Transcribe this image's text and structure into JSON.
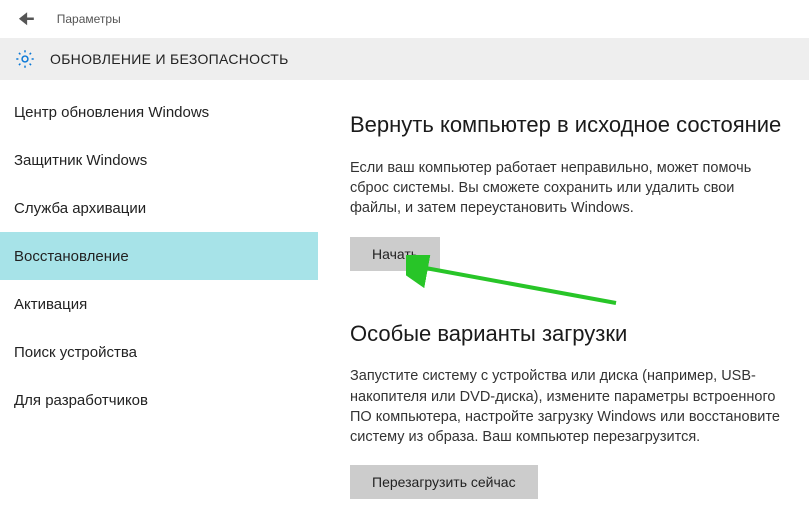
{
  "header": {
    "title": "Параметры"
  },
  "category": {
    "title": "ОБНОВЛЕНИЕ И БЕЗОПАСНОСТЬ"
  },
  "sidebar": {
    "items": [
      {
        "label": "Центр обновления Windows",
        "selected": false
      },
      {
        "label": "Защитник Windows",
        "selected": false
      },
      {
        "label": "Служба архивации",
        "selected": false
      },
      {
        "label": "Восстановление",
        "selected": true
      },
      {
        "label": "Активация",
        "selected": false
      },
      {
        "label": "Поиск устройства",
        "selected": false
      },
      {
        "label": "Для разработчиков",
        "selected": false
      }
    ]
  },
  "main": {
    "reset": {
      "heading": "Вернуть компьютер в исходное состояние",
      "text": "Если ваш компьютер работает неправильно, может помочь сброс системы. Вы сможете сохранить или удалить свои файлы, и затем переустановить Windows.",
      "button": "Начать"
    },
    "advanced": {
      "heading": "Особые варианты загрузки",
      "text": "Запустите систему с устройства или диска (например, USB-накопителя или DVD-диска), измените параметры встроенного ПО компьютера, настройте загрузку Windows или восстановите систему из образа. Ваш компьютер перезагрузится.",
      "button": "Перезагрузить сейчас"
    }
  },
  "annotation": {
    "arrow_color": "#28c528"
  }
}
